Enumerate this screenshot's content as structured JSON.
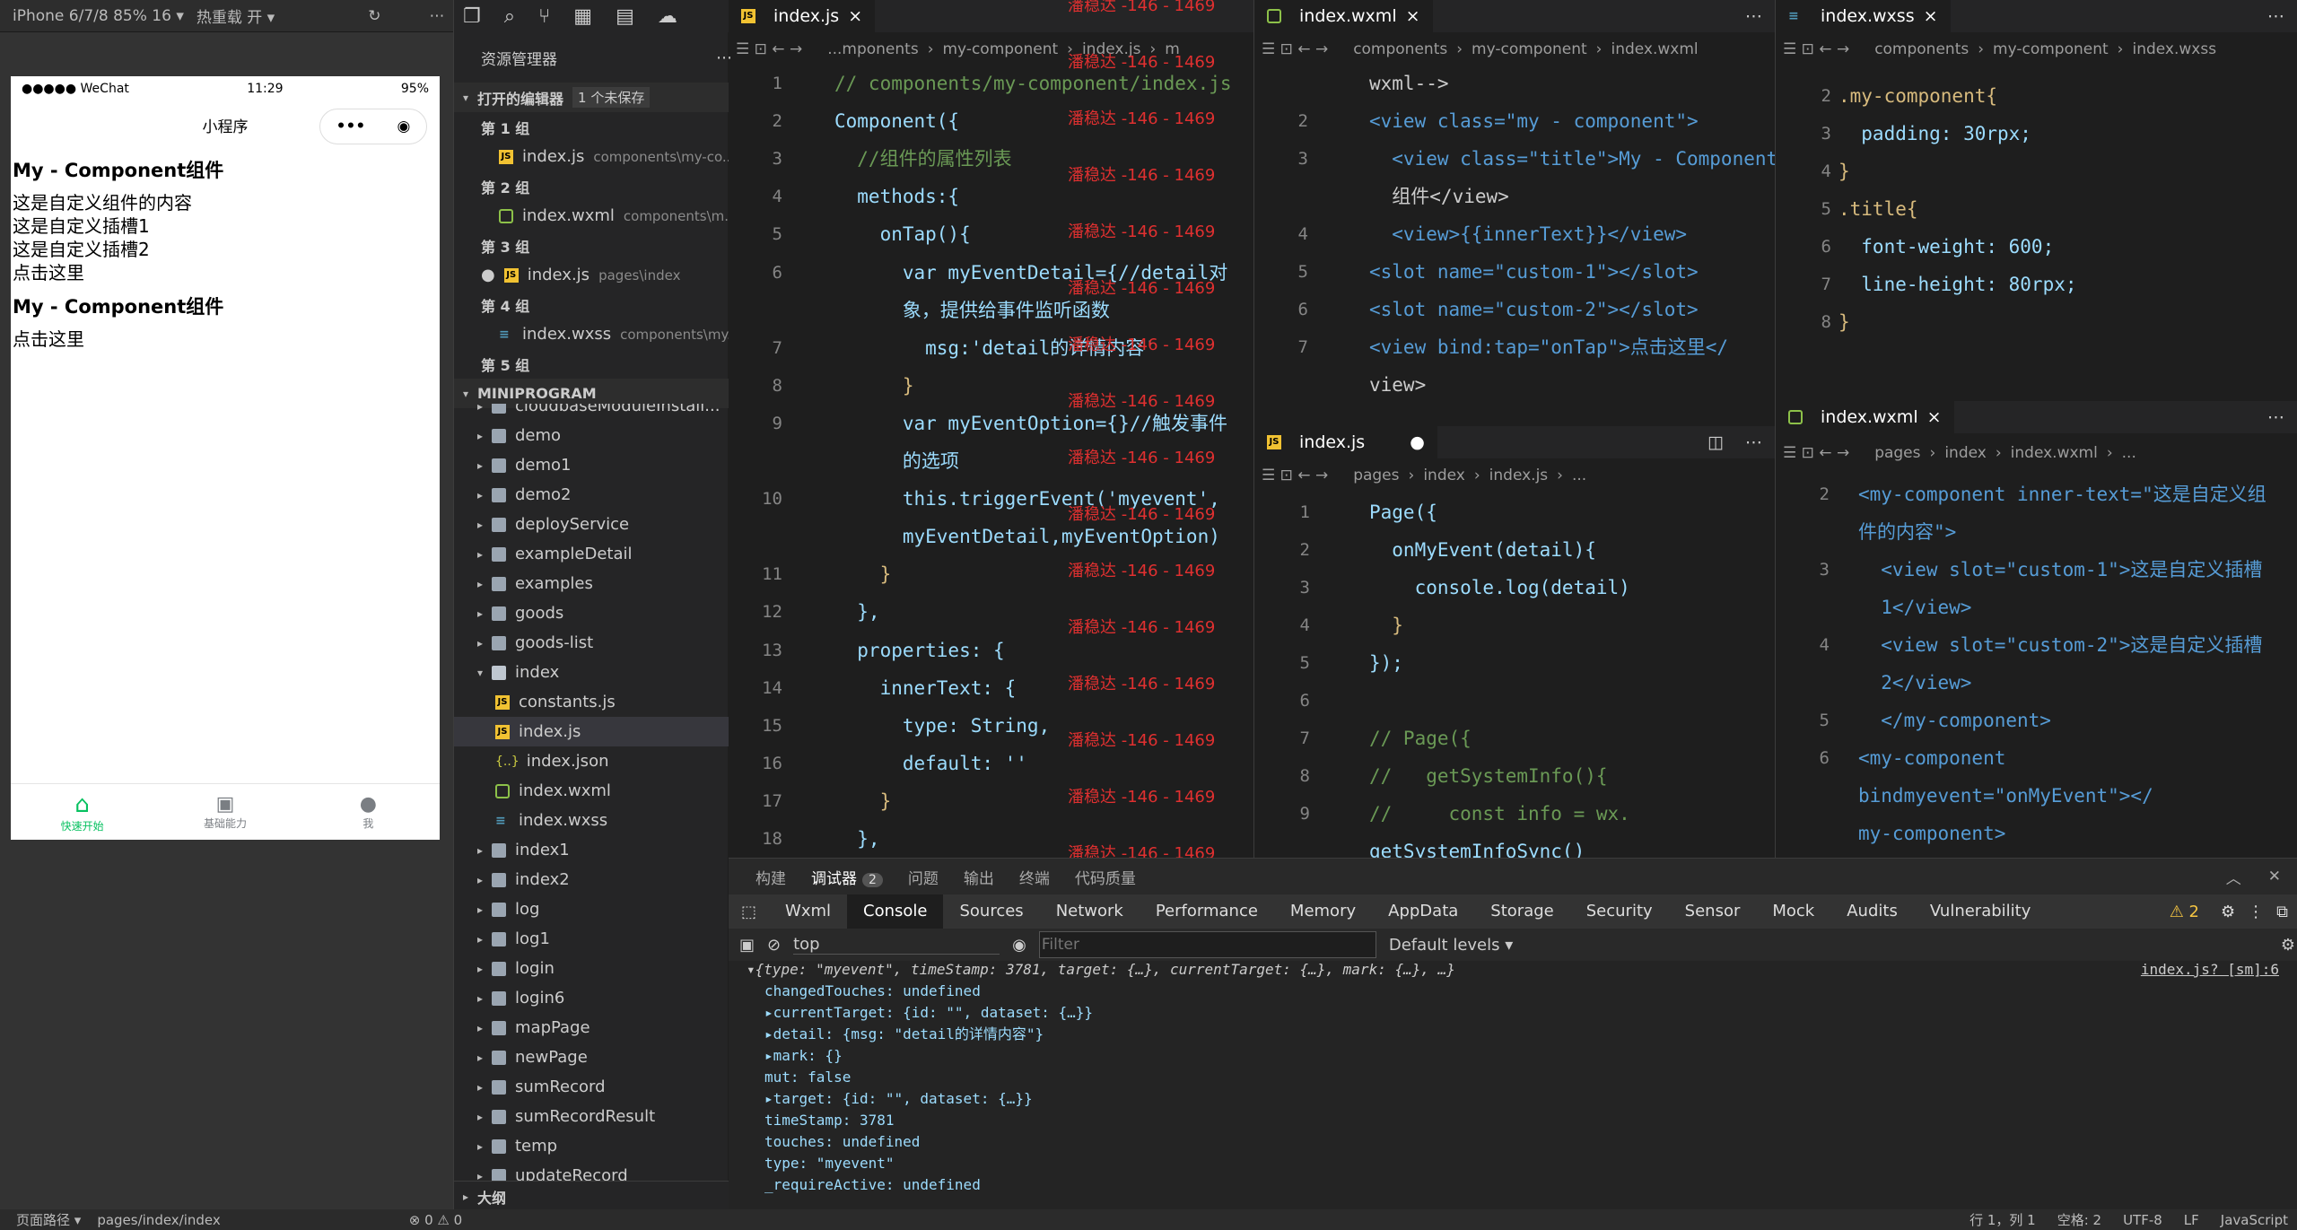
{
  "simulator": {
    "device_label": "iPhone 6/7/8 85% 16 ▾",
    "hot_reload": "热重载 开 ▾",
    "phone": {
      "carrier": "●●●●● WeChat",
      "time": "11:29",
      "battery": "95%",
      "title": "小程序",
      "lines": [
        "My - Component组件",
        "这是自定义组件的内容",
        "这是自定义插槽1",
        "这是自定义插槽2",
        "点击这里",
        "My - Component组件",
        "点击这里"
      ],
      "tabs": [
        {
          "label": "快速开始",
          "icon": "home-icon"
        },
        {
          "label": "基础能力",
          "icon": "terminal-icon"
        },
        {
          "label": "我",
          "icon": "user-icon"
        }
      ]
    }
  },
  "explorer": {
    "title": "资源管理器",
    "open_editors": "打开的编辑器",
    "unsaved": "1 个未保存",
    "groups": [
      {
        "label": "第 1 组",
        "file": "index.js",
        "path": "components\\my-co...",
        "type": "js"
      },
      {
        "label": "第 2 组",
        "file": "index.wxml",
        "path": "components\\m...",
        "type": "wxml"
      },
      {
        "label": "第 3 组",
        "file": "index.js",
        "path": "pages\\index",
        "type": "js"
      },
      {
        "label": "第 4 组",
        "file": "index.wxss",
        "path": "components\\my...",
        "type": "wxss"
      },
      {
        "label": "第 5 组"
      }
    ],
    "project": "MINIPROGRAM",
    "tree": [
      "cloudbaseModuleInstall...",
      "demo",
      "demo1",
      "demo2",
      "deployService",
      "exampleDetail",
      "examples",
      "goods",
      "goods-list",
      "index",
      "constants.js",
      "index.js",
      "index.json",
      "index.wxml",
      "index.wxss",
      "index1",
      "index2",
      "log",
      "log1",
      "login",
      "login6",
      "mapPage",
      "newPage",
      "sumRecord",
      "sumRecordResult",
      "temp",
      "updateRecord"
    ],
    "outline": "大纲"
  },
  "editor1": {
    "tab": "index.js",
    "crumbs": [
      "...mponents",
      "my-component",
      "index.js",
      "m"
    ],
    "line_numbers": [
      "1",
      "2",
      "3",
      "4",
      "5",
      "6",
      "",
      "7",
      "8",
      "9",
      "",
      "10",
      "",
      "11",
      "12",
      "13",
      "14",
      "15",
      "16",
      "17",
      "18"
    ],
    "lines": [
      "// components/my-component/index.js",
      "Component({",
      "  //组件的属性列表",
      "  methods:{",
      "    onTap(){",
      "      var myEventDetail={//detail对",
      "      象，提供给事件监听函数",
      "        msg:'detail的详情内容'",
      "      }",
      "      var myEventOption={}//触发事件",
      "      的选项",
      "      this.triggerEvent('myevent',",
      "      myEventDetail,myEventOption)",
      "    }",
      "  },",
      "  properties: {",
      "    innerText: {",
      "      type: String,",
      "      default: ''",
      "    }",
      "  },"
    ]
  },
  "watermark": "潘稳达 -146 - 1469",
  "editor2": {
    "tab": "index.wxml",
    "crumbs": [
      "components",
      "my-component",
      "index.wxml"
    ],
    "line_numbers": [
      "",
      "2",
      "3",
      "",
      "4",
      "5",
      "6",
      "7",
      ""
    ],
    "lines": [
      "wxml-->",
      "<view class=\"my - component\">",
      "  <view class=\"title\">My - Component",
      "  组件</view>",
      "  <view>{{innerText}}</view>",
      "<slot name=\"custom-1\"></slot>",
      "<slot name=\"custom-2\"></slot>",
      "<view bind:tap=\"onTap\">点击这里</",
      "view>"
    ]
  },
  "editor3": {
    "tab": "index.wxss",
    "crumbs": [
      "components",
      "my-component",
      "index.wxss"
    ],
    "line_numbers": [
      "2",
      "3",
      "4",
      "5",
      "6",
      "7",
      "8"
    ],
    "lines": [
      ".my-component{",
      "  padding: 30rpx;",
      "}",
      ".title{",
      "  font-weight: 600;",
      "  line-height: 80rpx;",
      "}"
    ]
  },
  "editor4": {
    "tab": "index.js",
    "crumbs": [
      "pages",
      "index",
      "index.js",
      "..."
    ],
    "line_numbers": [
      "1",
      "2",
      "3",
      "4",
      "5",
      "6",
      "7",
      "8",
      "9",
      ""
    ],
    "lines": [
      "Page({",
      "  onMyEvent(detail){",
      "    console.log(detail)",
      "  }",
      "});",
      "",
      "// Page({",
      "//   getSystemInfo(){",
      "//     const info = wx.",
      "getSystemInfoSync()"
    ]
  },
  "editor5": {
    "tab": "index.wxml",
    "crumbs": [
      "pages",
      "index",
      "index.wxml",
      "..."
    ],
    "line_numbers": [
      "2",
      "",
      "3",
      "",
      "4",
      "",
      "5",
      "6",
      "",
      ""
    ],
    "lines": [
      "<my-component inner-text=\"这是自定义组",
      "件的内容\">",
      "  <view slot=\"custom-1\">这是自定义插槽",
      "  1</view>",
      "  <view slot=\"custom-2\">这是自定义插槽",
      "  2</view>",
      "  </my-component>",
      "<my-component",
      "bindmyevent=\"onMyEvent\"></",
      "my-component>"
    ]
  },
  "devtools": {
    "tabs": [
      "构建",
      "调试器",
      "问题",
      "输出",
      "终端",
      "代码质量"
    ],
    "debugger_count": "2",
    "panels": [
      "Wxml",
      "Console",
      "Sources",
      "Network",
      "Performance",
      "Memory",
      "AppData",
      "Storage",
      "Security",
      "Sensor",
      "Mock",
      "Audits",
      "Vulnerability"
    ],
    "warn_count": "2",
    "context": "top",
    "filter_placeholder": "Filter",
    "levels": "Default levels ▾",
    "source_link": "index.js? [sm]:6",
    "log": [
      "▾{type: \"myevent\", timeStamp: 3781, target: {…}, currentTarget: {…}, mark: {…}, …}",
      "changedTouches: undefined",
      "▸currentTarget: {id: \"\", dataset: {…}}",
      "▸detail: {msg: \"detail的详情内容\"}",
      "▸mark: {}",
      "mut: false",
      "▸target: {id: \"\", dataset: {…}}",
      "timeStamp: 3781",
      "touches: undefined",
      "type: \"myevent\"",
      "_requireActive: undefined"
    ]
  },
  "statusbar": {
    "path_label": "页面路径 ▾",
    "path": "pages/index/index",
    "problems": "⊗ 0 ⚠ 0",
    "position": "行 1，列 1",
    "spaces": "空格: 2",
    "encoding": "UTF-8",
    "eol": "LF",
    "language": "JavaScript"
  }
}
